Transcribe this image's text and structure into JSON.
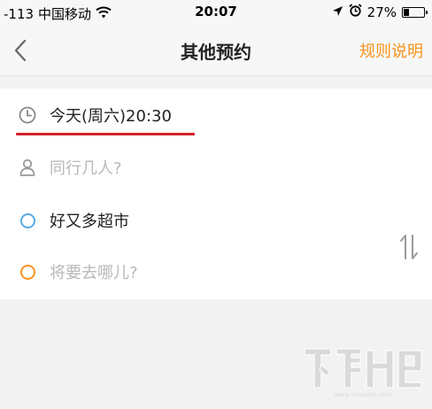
{
  "status_bar": {
    "signal": "-113",
    "carrier": "中国移动",
    "time": "20:07",
    "battery_percent": "27%",
    "battery_level": 0.27
  },
  "nav": {
    "title": "其他预约",
    "rules_label": "规则说明"
  },
  "form": {
    "time_value": "今天(周六)20:30",
    "people_placeholder": "同行几人?",
    "from_value": "好又多超市",
    "to_placeholder": "将要去哪儿?"
  },
  "colors": {
    "accent": "#f7931e",
    "underline": "#d4222a",
    "origin_dot": "#5aaae6",
    "destination_dot": "#f7931e"
  },
  "icons": [
    "back-icon",
    "wifi-icon",
    "location-arrow-icon",
    "alarm-icon",
    "battery-icon",
    "clock-icon",
    "person-icon",
    "swap-icon"
  ],
  "watermark": {
    "domain": "www.xiazaiba.com"
  }
}
